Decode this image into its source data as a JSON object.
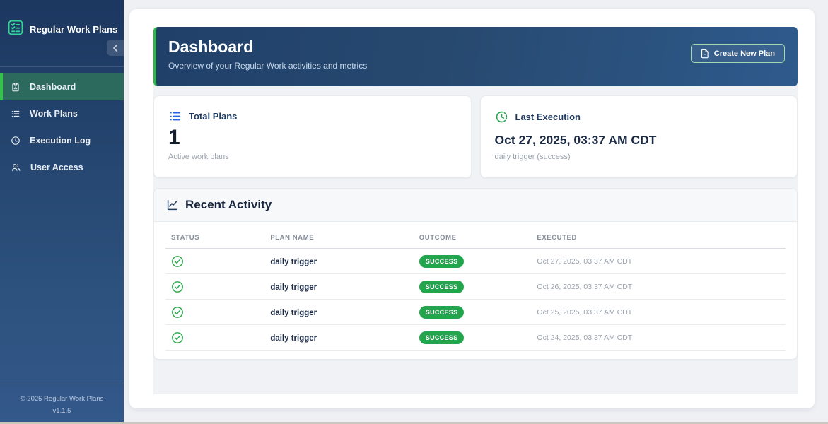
{
  "sidebar": {
    "title": "Regular Work Plans",
    "items": [
      {
        "label": "Dashboard",
        "icon": "dashboard-icon",
        "active": true
      },
      {
        "label": "Work Plans",
        "icon": "list-icon",
        "active": false
      },
      {
        "label": "Execution Log",
        "icon": "clock-icon",
        "active": false
      },
      {
        "label": "User Access",
        "icon": "users-icon",
        "active": false
      }
    ],
    "footer": {
      "copyright": "© 2025 Regular Work Plans",
      "version": "v1.1.5"
    }
  },
  "header": {
    "title": "Dashboard",
    "subtitle": "Overview of your Regular Work activities and metrics",
    "create_button_label": "Create New Plan"
  },
  "stats": {
    "total_plans": {
      "label": "Total Plans",
      "value": "1",
      "description": "Active work plans",
      "icon": "list-icon"
    },
    "last_execution": {
      "label": "Last Execution",
      "value": "Oct 27, 2025, 03:37 AM CDT",
      "description": "daily trigger (success)",
      "icon": "clock-icon"
    }
  },
  "recent_activity": {
    "title": "Recent Activity",
    "icon": "line-chart-icon",
    "columns": [
      "STATUS",
      "PLAN NAME",
      "OUTCOME",
      "EXECUTED"
    ],
    "rows": [
      {
        "status": "success",
        "plan_name": "daily trigger",
        "outcome": "SUCCESS",
        "executed": "Oct 27, 2025, 03:37 AM CDT"
      },
      {
        "status": "success",
        "plan_name": "daily trigger",
        "outcome": "SUCCESS",
        "executed": "Oct 26, 2025, 03:37 AM CDT"
      },
      {
        "status": "success",
        "plan_name": "daily trigger",
        "outcome": "SUCCESS",
        "executed": "Oct 25, 2025, 03:37 AM CDT"
      },
      {
        "status": "success",
        "plan_name": "daily trigger",
        "outcome": "SUCCESS",
        "executed": "Oct 24, 2025, 03:37 AM CDT"
      }
    ]
  },
  "colors": {
    "accent_green": "#2fb34c",
    "success_green": "#23a54e",
    "active_nav_bg": "#2d6a5e",
    "sidebar_top": "#1c3760",
    "sidebar_bottom": "#33588a",
    "banner_left": "#20406a",
    "banner_right": "#2e5a8c",
    "stat_icon_blue": "#2563eb",
    "heading_navy": "#1f3a61"
  }
}
